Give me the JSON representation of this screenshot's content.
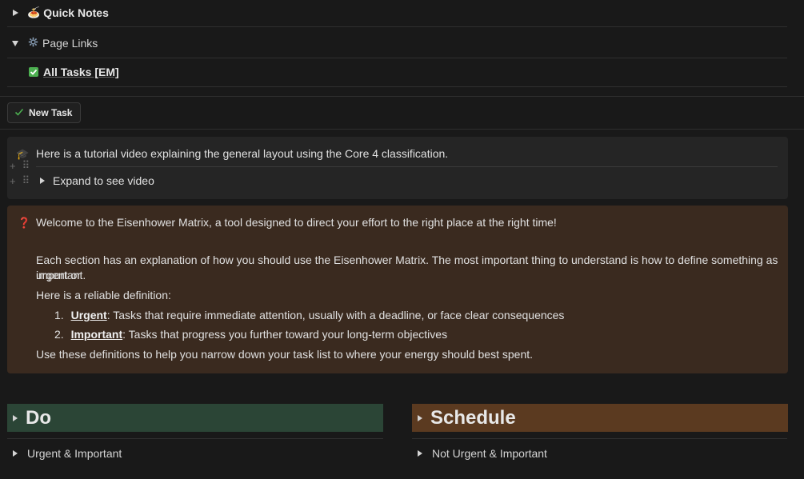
{
  "toggles": {
    "quick_notes": {
      "icon": "🍝",
      "label": "Quick Notes"
    },
    "page_links": {
      "label": "Page Links"
    },
    "all_tasks": {
      "label": "All Tasks [EM]"
    }
  },
  "new_task_button": {
    "label": "New Task"
  },
  "tutorial_callout": {
    "icon": "🎓",
    "text": "Here is a tutorial video explaining the general layout using the Core 4 classification.",
    "expand_label": "Expand to see video"
  },
  "info_callout": {
    "icon": "❓",
    "intro": "Welcome to the Eisenhower Matrix, a tool designed to direct your effort to the right place at the right time!",
    "para_line1": "Each section has an explanation of how you should use the Eisenhower Matrix. The most important thing to understand is how to define something as urgent or",
    "para_line2": "important.",
    "definition_lead": "Here is a reliable definition:",
    "list": [
      {
        "num": "1.",
        "term": "Urgent",
        "desc": ": Tasks that require immediate attention, usually with a deadline, or face clear consequences"
      },
      {
        "num": "2.",
        "term": "Important",
        "desc": ": Tasks that progress you further toward your long-term objectives"
      }
    ],
    "closing": "Use these definitions to help you narrow down your task list to where your energy should best spent."
  },
  "sections": {
    "do": {
      "title": "Do",
      "color": "#2b4536",
      "sub": "Urgent & Important"
    },
    "schedule": {
      "title": "Schedule",
      "color": "#5b3a20",
      "sub": "Not Urgent & Important"
    }
  },
  "colors": {
    "background": "#191919",
    "check_green": "#4caf50"
  }
}
